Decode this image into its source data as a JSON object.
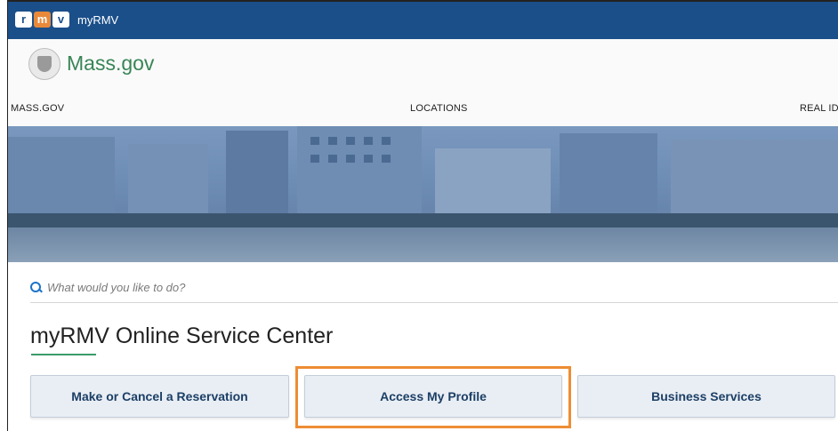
{
  "topbar": {
    "logo_letters": [
      "r",
      "m",
      "v"
    ],
    "app_name": "myRMV",
    "bg_color": "#1b4f8a"
  },
  "header": {
    "site_name": "Mass.gov",
    "nav_items": [
      "MASS.GOV",
      "LOCATIONS",
      "REAL ID"
    ]
  },
  "search": {
    "placeholder": "What would you like to do?"
  },
  "main": {
    "title": "myRMV Online Service Center",
    "buttons": [
      {
        "label": "Make or Cancel a Reservation"
      },
      {
        "label": "Access My Profile",
        "highlighted": true
      },
      {
        "label": "Business Services"
      }
    ]
  },
  "colors": {
    "brand_blue": "#1b4f8a",
    "mass_green": "#388557",
    "highlight_orange": "#ee8d33",
    "button_text": "#1c3f66"
  }
}
